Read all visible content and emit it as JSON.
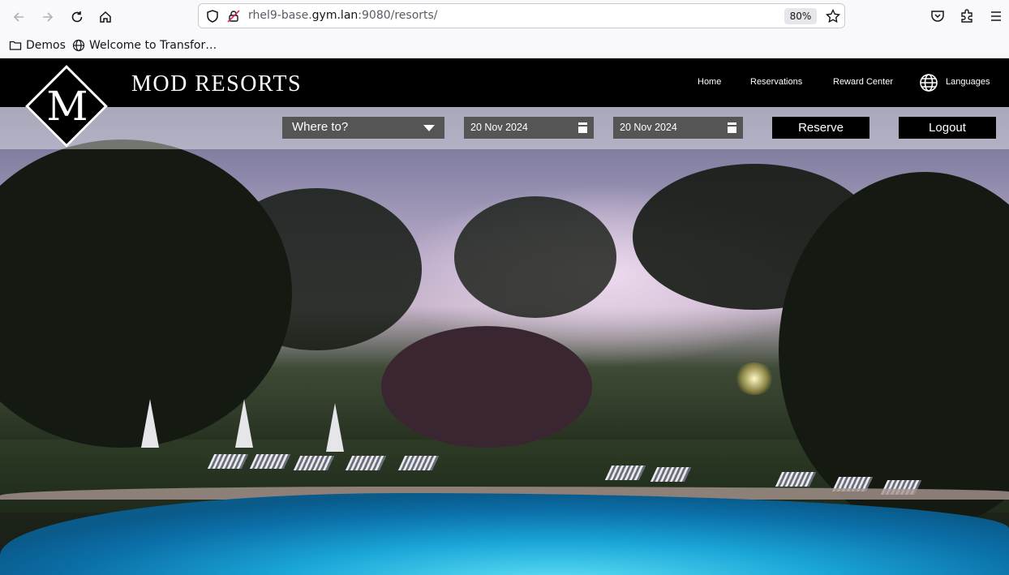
{
  "browser": {
    "url_prefix": "rhel9-base.",
    "url_host": "gym.lan",
    "url_suffix": ":9080/resorts/",
    "zoom": "80%",
    "bookmarks": [
      {
        "label": "Demos",
        "icon": "folder-icon"
      },
      {
        "label": "Welcome to Transfor…",
        "icon": "globe-icon"
      }
    ]
  },
  "site": {
    "brand": "MOD RESORTS",
    "logo_letter": "M",
    "nav": [
      "Home",
      "Reservations",
      "Reward Center"
    ],
    "languages_label": "Languages"
  },
  "search": {
    "destination": "Where to?",
    "checkin": "20 Nov 2024",
    "checkout": "20 Nov 2024",
    "reserve_label": "Reserve",
    "logout_label": "Logout"
  },
  "colors": {
    "header_bg": "#000000",
    "input_bg": "#555555",
    "text": "#ffffff"
  }
}
